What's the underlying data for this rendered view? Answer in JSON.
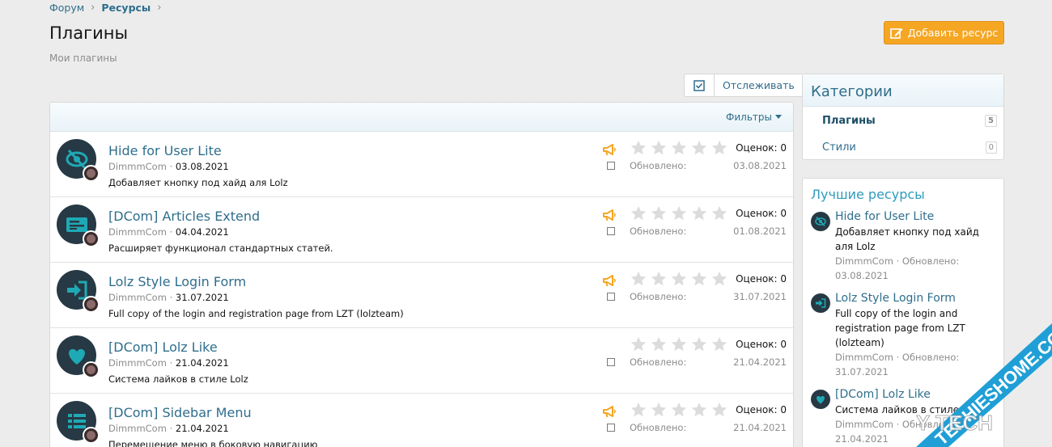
{
  "breadcrumb": {
    "items": [
      "Форум",
      "Ресурсы"
    ]
  },
  "page": {
    "title": "Плагины",
    "description": "Мои плагины"
  },
  "toolbar": {
    "add_label": "Добавить ресурс",
    "watch_label": "Отслеживать",
    "filters_label": "Фильтры"
  },
  "list": {
    "rating_prefix": "Оценок: ",
    "updated_label": "Обновлено:",
    "resources": [
      {
        "title": "Hide for User Lite",
        "author": "DimmmCom",
        "date": "03.08.2021",
        "description": "Добавляет кнопку под хайд аля Lolz",
        "ratings": "0",
        "updated": "03.08.2021",
        "horn": true,
        "icon": "eye-slash-icon"
      },
      {
        "title": "[DCom] Articles Extend",
        "author": "DimmmCom",
        "date": "04.04.2021",
        "description": "Расширяет функционал стандартных статей.",
        "ratings": "0",
        "updated": "01.08.2021",
        "horn": true,
        "icon": "article-icon"
      },
      {
        "title": "Lolz Style Login Form",
        "author": "DimmmCom",
        "date": "31.07.2021",
        "description": "Full copy of the login and registration page from LZT (lolzteam)",
        "ratings": "0",
        "updated": "31.07.2021",
        "horn": true,
        "icon": "login-arrow-icon"
      },
      {
        "title": "[DCom] Lolz Like",
        "author": "DimmmCom",
        "date": "21.04.2021",
        "description": "Система лайков в стиле Lolz",
        "ratings": "0",
        "updated": "21.04.2021",
        "horn": false,
        "icon": "heart-icon"
      },
      {
        "title": "[DCom] Sidebar Menu",
        "author": "DimmmCom",
        "date": "21.04.2021",
        "description": "Перемещение меню в боковую навигацию",
        "ratings": "0",
        "updated": "21.04.2021",
        "horn": true,
        "icon": "menu-list-icon"
      }
    ]
  },
  "sidebar": {
    "categories_title": "Категории",
    "categories": [
      {
        "label": "Плагины",
        "count": "5",
        "active": true
      },
      {
        "label": "Стили",
        "count": "0",
        "active": false
      }
    ],
    "best_title": "Лучшие ресурсы",
    "best": [
      {
        "title": "Hide for User Lite",
        "description": "Добавляет кнопку под хайд аля Lolz",
        "meta": "DimmmCom · Обновлено:",
        "date": "03.08.2021"
      },
      {
        "title": "Lolz Style Login Form",
        "description": "Full copy of the login and registration page from LZT (lolzteam)",
        "meta": "DimmmCom · Обновлено:",
        "date": "31.07.2021"
      },
      {
        "title": "[DCom] Lolz Like",
        "description": "Система лайков в стиле Lolz",
        "meta": "DimmmCom · Обновлено:",
        "date": "21.04.2021"
      }
    ]
  },
  "watermark": {
    "line1": "TECHIESHOME.COM",
    "line2": "Y TECH"
  },
  "colors": {
    "link": "#2f6e8c",
    "accent": "#f5a623",
    "icon_teal": "#1fa9b5",
    "avatar_bg": "#263944",
    "star_empty": "#dcdcdc"
  }
}
